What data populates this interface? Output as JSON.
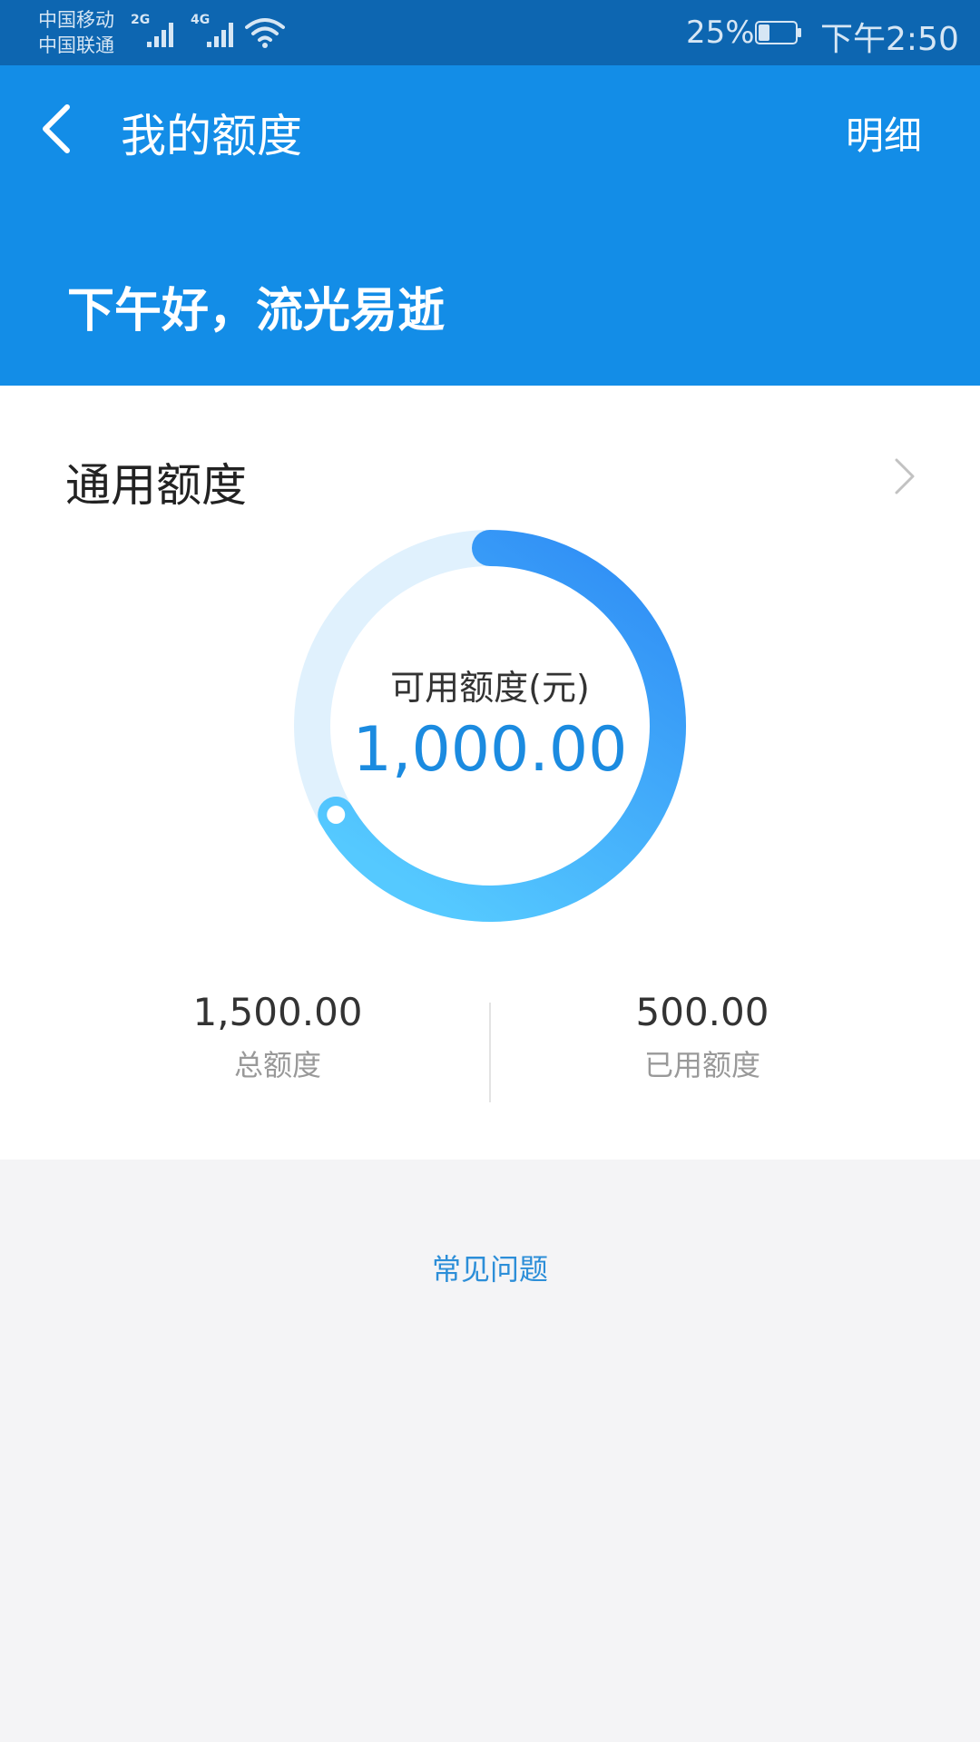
{
  "status_bar": {
    "carrier_1": "中国移动",
    "carrier_2": "中国联通",
    "signal_1_type": "2G",
    "signal_2_type": "4G",
    "battery": "25%",
    "time": "下午2:50"
  },
  "header": {
    "title": "我的额度",
    "detail_link": "明细",
    "greeting": "下午好，流光易逝"
  },
  "credit_card": {
    "title": "通用额度",
    "available_label": "可用额度(元)",
    "available_value": "1,000.00",
    "available_fraction": 0.6667,
    "total_value": "1,500.00",
    "total_label": "总额度",
    "used_value": "500.00",
    "used_label": "已用额度"
  },
  "faq": {
    "label": "常见问题"
  },
  "colors": {
    "status_bar": "#0d66b1",
    "header": "#138de7",
    "accent": "#1b8be0",
    "ring_track": "#e0f1fd",
    "ring_start": "#2f8df5",
    "ring_end": "#55c9ff",
    "page_bg": "#f4f4f6"
  },
  "icons": {
    "back": "chevron-left-icon",
    "card_arrow": "chevron-right-icon",
    "signal": "signal-bars-icon",
    "wifi": "wifi-icon",
    "battery": "battery-icon"
  }
}
